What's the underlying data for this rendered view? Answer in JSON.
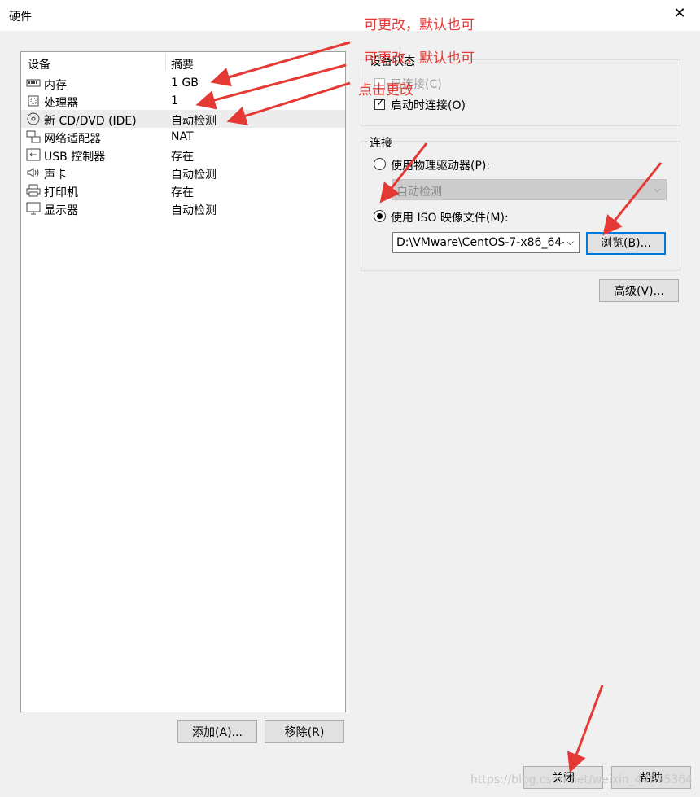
{
  "window": {
    "title": "硬件",
    "close_glyph": "✕"
  },
  "device_list": {
    "headers": [
      "设备",
      "摘要"
    ],
    "rows": [
      {
        "icon": "memory-icon",
        "name": "内存",
        "summary": "1 GB"
      },
      {
        "icon": "processor-icon",
        "name": "处理器",
        "summary": "1"
      },
      {
        "icon": "cd-dvd-icon",
        "name": "新 CD/DVD (IDE)",
        "summary": "自动检测",
        "selected": true
      },
      {
        "icon": "network-adapter-icon",
        "name": "网络适配器",
        "summary": "NAT"
      },
      {
        "icon": "usb-icon",
        "name": "USB 控制器",
        "summary": "存在"
      },
      {
        "icon": "speaker-icon",
        "name": "声卡",
        "summary": "自动检测"
      },
      {
        "icon": "printer-icon",
        "name": "打印机",
        "summary": "存在"
      },
      {
        "icon": "display-icon",
        "name": "显示器",
        "summary": "自动检测"
      }
    ]
  },
  "buttons": {
    "add": "添加(A)...",
    "remove": "移除(R)",
    "browse": "浏览(B)...",
    "advanced": "高级(V)...",
    "close": "关闭",
    "help": "帮助"
  },
  "device_status": {
    "legend": "设备状态",
    "connected": {
      "label": "已连接(C)",
      "checked": false,
      "enabled": false
    },
    "connect_at_power_on": {
      "label": "启动时连接(O)",
      "checked": true
    }
  },
  "connection": {
    "legend": "连接",
    "physical_drive": {
      "label": "使用物理驱动器(P):",
      "selected": false,
      "value": "自动检测"
    },
    "iso_image": {
      "label": "使用 ISO 映像文件(M):",
      "selected": true,
      "value": "D:\\VMware\\CentOS-7-x86_64-"
    }
  },
  "annotations": {
    "note1": "可更改，默认也可",
    "note2": "可更改，默认也可",
    "note3": "点击更改",
    "color": "#e53935"
  },
  "watermark": "https://blog.csdn.net/weixin_44995364",
  "colors": {
    "focus_border": "#0078d7",
    "selected_row": "#ececec",
    "window_bg": "#f0f0f0"
  }
}
